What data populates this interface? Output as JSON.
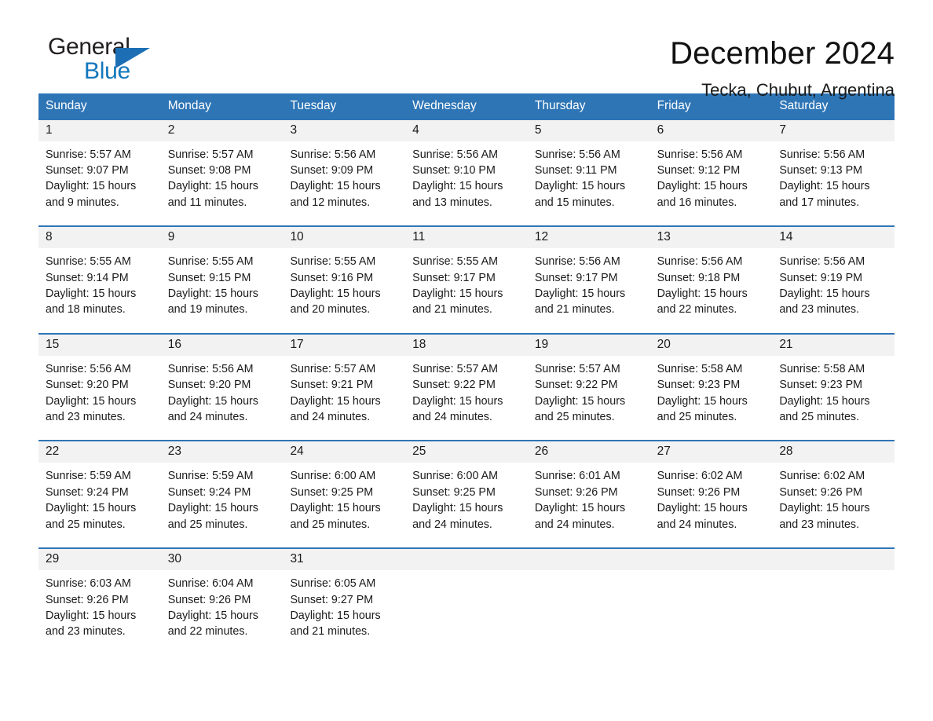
{
  "brand": {
    "name_part1": "General",
    "name_part2": "Blue",
    "triangle_color": "#1c6fb5"
  },
  "header": {
    "title": "December 2024",
    "subtitle": "Tecka, Chubut, Argentina"
  },
  "colors": {
    "header_blue": "#2E75B6",
    "row_band_grey": "#F2F2F2",
    "brand_blue": "#1277BC",
    "text": "#1A1A1A"
  },
  "calendar": {
    "day_headers": [
      "Sunday",
      "Monday",
      "Tuesday",
      "Wednesday",
      "Thursday",
      "Friday",
      "Saturday"
    ],
    "weeks": [
      [
        {
          "day": "1",
          "sunrise": "Sunrise: 5:57 AM",
          "sunset": "Sunset: 9:07 PM",
          "daylight_line1": "Daylight: 15 hours",
          "daylight_line2": "and 9 minutes."
        },
        {
          "day": "2",
          "sunrise": "Sunrise: 5:57 AM",
          "sunset": "Sunset: 9:08 PM",
          "daylight_line1": "Daylight: 15 hours",
          "daylight_line2": "and 11 minutes."
        },
        {
          "day": "3",
          "sunrise": "Sunrise: 5:56 AM",
          "sunset": "Sunset: 9:09 PM",
          "daylight_line1": "Daylight: 15 hours",
          "daylight_line2": "and 12 minutes."
        },
        {
          "day": "4",
          "sunrise": "Sunrise: 5:56 AM",
          "sunset": "Sunset: 9:10 PM",
          "daylight_line1": "Daylight: 15 hours",
          "daylight_line2": "and 13 minutes."
        },
        {
          "day": "5",
          "sunrise": "Sunrise: 5:56 AM",
          "sunset": "Sunset: 9:11 PM",
          "daylight_line1": "Daylight: 15 hours",
          "daylight_line2": "and 15 minutes."
        },
        {
          "day": "6",
          "sunrise": "Sunrise: 5:56 AM",
          "sunset": "Sunset: 9:12 PM",
          "daylight_line1": "Daylight: 15 hours",
          "daylight_line2": "and 16 minutes."
        },
        {
          "day": "7",
          "sunrise": "Sunrise: 5:56 AM",
          "sunset": "Sunset: 9:13 PM",
          "daylight_line1": "Daylight: 15 hours",
          "daylight_line2": "and 17 minutes."
        }
      ],
      [
        {
          "day": "8",
          "sunrise": "Sunrise: 5:55 AM",
          "sunset": "Sunset: 9:14 PM",
          "daylight_line1": "Daylight: 15 hours",
          "daylight_line2": "and 18 minutes."
        },
        {
          "day": "9",
          "sunrise": "Sunrise: 5:55 AM",
          "sunset": "Sunset: 9:15 PM",
          "daylight_line1": "Daylight: 15 hours",
          "daylight_line2": "and 19 minutes."
        },
        {
          "day": "10",
          "sunrise": "Sunrise: 5:55 AM",
          "sunset": "Sunset: 9:16 PM",
          "daylight_line1": "Daylight: 15 hours",
          "daylight_line2": "and 20 minutes."
        },
        {
          "day": "11",
          "sunrise": "Sunrise: 5:55 AM",
          "sunset": "Sunset: 9:17 PM",
          "daylight_line1": "Daylight: 15 hours",
          "daylight_line2": "and 21 minutes."
        },
        {
          "day": "12",
          "sunrise": "Sunrise: 5:56 AM",
          "sunset": "Sunset: 9:17 PM",
          "daylight_line1": "Daylight: 15 hours",
          "daylight_line2": "and 21 minutes."
        },
        {
          "day": "13",
          "sunrise": "Sunrise: 5:56 AM",
          "sunset": "Sunset: 9:18 PM",
          "daylight_line1": "Daylight: 15 hours",
          "daylight_line2": "and 22 minutes."
        },
        {
          "day": "14",
          "sunrise": "Sunrise: 5:56 AM",
          "sunset": "Sunset: 9:19 PM",
          "daylight_line1": "Daylight: 15 hours",
          "daylight_line2": "and 23 minutes."
        }
      ],
      [
        {
          "day": "15",
          "sunrise": "Sunrise: 5:56 AM",
          "sunset": "Sunset: 9:20 PM",
          "daylight_line1": "Daylight: 15 hours",
          "daylight_line2": "and 23 minutes."
        },
        {
          "day": "16",
          "sunrise": "Sunrise: 5:56 AM",
          "sunset": "Sunset: 9:20 PM",
          "daylight_line1": "Daylight: 15 hours",
          "daylight_line2": "and 24 minutes."
        },
        {
          "day": "17",
          "sunrise": "Sunrise: 5:57 AM",
          "sunset": "Sunset: 9:21 PM",
          "daylight_line1": "Daylight: 15 hours",
          "daylight_line2": "and 24 minutes."
        },
        {
          "day": "18",
          "sunrise": "Sunrise: 5:57 AM",
          "sunset": "Sunset: 9:22 PM",
          "daylight_line1": "Daylight: 15 hours",
          "daylight_line2": "and 24 minutes."
        },
        {
          "day": "19",
          "sunrise": "Sunrise: 5:57 AM",
          "sunset": "Sunset: 9:22 PM",
          "daylight_line1": "Daylight: 15 hours",
          "daylight_line2": "and 25 minutes."
        },
        {
          "day": "20",
          "sunrise": "Sunrise: 5:58 AM",
          "sunset": "Sunset: 9:23 PM",
          "daylight_line1": "Daylight: 15 hours",
          "daylight_line2": "and 25 minutes."
        },
        {
          "day": "21",
          "sunrise": "Sunrise: 5:58 AM",
          "sunset": "Sunset: 9:23 PM",
          "daylight_line1": "Daylight: 15 hours",
          "daylight_line2": "and 25 minutes."
        }
      ],
      [
        {
          "day": "22",
          "sunrise": "Sunrise: 5:59 AM",
          "sunset": "Sunset: 9:24 PM",
          "daylight_line1": "Daylight: 15 hours",
          "daylight_line2": "and 25 minutes."
        },
        {
          "day": "23",
          "sunrise": "Sunrise: 5:59 AM",
          "sunset": "Sunset: 9:24 PM",
          "daylight_line1": "Daylight: 15 hours",
          "daylight_line2": "and 25 minutes."
        },
        {
          "day": "24",
          "sunrise": "Sunrise: 6:00 AM",
          "sunset": "Sunset: 9:25 PM",
          "daylight_line1": "Daylight: 15 hours",
          "daylight_line2": "and 25 minutes."
        },
        {
          "day": "25",
          "sunrise": "Sunrise: 6:00 AM",
          "sunset": "Sunset: 9:25 PM",
          "daylight_line1": "Daylight: 15 hours",
          "daylight_line2": "and 24 minutes."
        },
        {
          "day": "26",
          "sunrise": "Sunrise: 6:01 AM",
          "sunset": "Sunset: 9:26 PM",
          "daylight_line1": "Daylight: 15 hours",
          "daylight_line2": "and 24 minutes."
        },
        {
          "day": "27",
          "sunrise": "Sunrise: 6:02 AM",
          "sunset": "Sunset: 9:26 PM",
          "daylight_line1": "Daylight: 15 hours",
          "daylight_line2": "and 24 minutes."
        },
        {
          "day": "28",
          "sunrise": "Sunrise: 6:02 AM",
          "sunset": "Sunset: 9:26 PM",
          "daylight_line1": "Daylight: 15 hours",
          "daylight_line2": "and 23 minutes."
        }
      ],
      [
        {
          "day": "29",
          "sunrise": "Sunrise: 6:03 AM",
          "sunset": "Sunset: 9:26 PM",
          "daylight_line1": "Daylight: 15 hours",
          "daylight_line2": "and 23 minutes."
        },
        {
          "day": "30",
          "sunrise": "Sunrise: 6:04 AM",
          "sunset": "Sunset: 9:26 PM",
          "daylight_line1": "Daylight: 15 hours",
          "daylight_line2": "and 22 minutes."
        },
        {
          "day": "31",
          "sunrise": "Sunrise: 6:05 AM",
          "sunset": "Sunset: 9:27 PM",
          "daylight_line1": "Daylight: 15 hours",
          "daylight_line2": "and 21 minutes."
        },
        {
          "day": "",
          "sunrise": "",
          "sunset": "",
          "daylight_line1": "",
          "daylight_line2": ""
        },
        {
          "day": "",
          "sunrise": "",
          "sunset": "",
          "daylight_line1": "",
          "daylight_line2": ""
        },
        {
          "day": "",
          "sunrise": "",
          "sunset": "",
          "daylight_line1": "",
          "daylight_line2": ""
        },
        {
          "day": "",
          "sunrise": "",
          "sunset": "",
          "daylight_line1": "",
          "daylight_line2": ""
        }
      ]
    ]
  }
}
